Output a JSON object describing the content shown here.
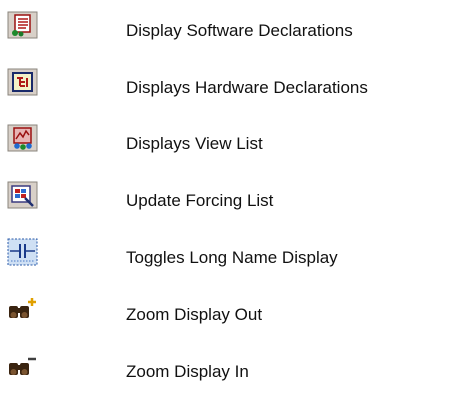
{
  "legend": {
    "items": [
      {
        "icon": "software-declarations-icon",
        "label": "Display Software Declarations"
      },
      {
        "icon": "hardware-declarations-icon",
        "label": "Displays Hardware Declarations"
      },
      {
        "icon": "view-list-icon",
        "label": "Displays View List"
      },
      {
        "icon": "forcing-list-icon",
        "label": "Update Forcing List"
      },
      {
        "icon": "long-name-toggle-icon",
        "label": "Toggles Long Name Display"
      },
      {
        "icon": "zoom-out-binoculars-icon",
        "label": "Zoom Display Out"
      },
      {
        "icon": "zoom-in-binoculars-icon",
        "label": "Zoom Display In"
      }
    ]
  }
}
